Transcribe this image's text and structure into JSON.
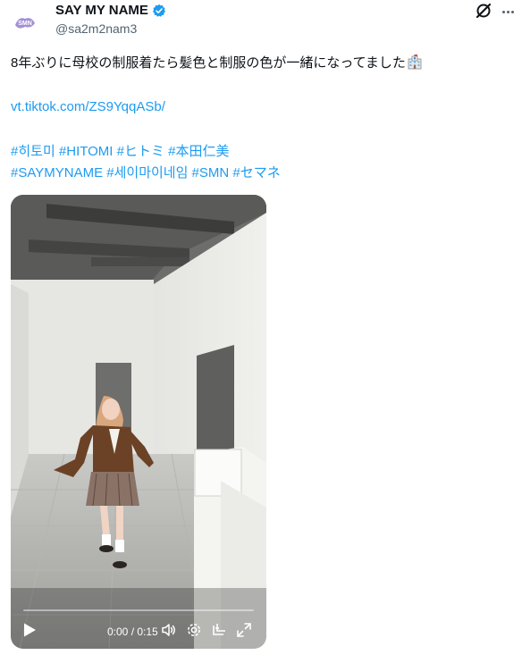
{
  "tweet": {
    "display_name": "SAY MY NAME",
    "handle": "@sa2m2nam3",
    "avatar_text": "SMN",
    "text_line1": "8年ぶりに母校の制服着たら髪色と制服の色が一緒になってました",
    "link": "vt.tiktok.com/ZS9YqqASb/",
    "hashtags_line1": "#히토미 #HITOMI #ヒトミ #本田仁美",
    "hashtags_line2": "#SAYMYNAME #세이마이네임 #SMN #セマネ",
    "emoji": "school-building-emoji"
  },
  "video": {
    "time_display": "0:00 / 0:15",
    "progress": 0.0,
    "controls": [
      "play-icon",
      "volume-icon",
      "settings-icon",
      "captions-icon",
      "fullscreen-icon"
    ]
  },
  "colors": {
    "link": "#1d9bf0",
    "text": "#0f1419",
    "secondary": "#536471",
    "verified": "#1d9bf0"
  }
}
